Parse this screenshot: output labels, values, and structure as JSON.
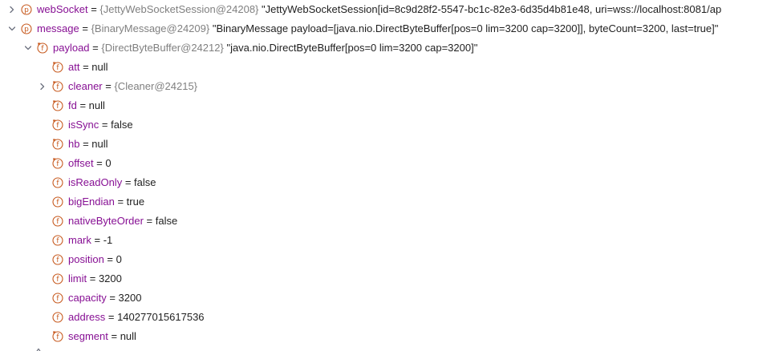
{
  "colors": {
    "field_name": "#871094",
    "type_ref": "#808080",
    "icon_orange": "#c75a1f",
    "chevron": "#6c707e"
  },
  "variables": [
    {
      "depth": 0,
      "expandable": true,
      "expanded": false,
      "icon": "p-property-icon",
      "name": "webSocket",
      "type_ref": "{JettyWebSocketSession@24208}",
      "value": "\"JettyWebSocketSession[id=8c9d28f2-5547-bc1c-82e3-6d35d4b81e48, uri=wss://localhost:8081/ap"
    },
    {
      "depth": 0,
      "expandable": true,
      "expanded": true,
      "icon": "p-property-icon",
      "name": "message",
      "type_ref": "{BinaryMessage@24209}",
      "value": "\"BinaryMessage payload=[java.nio.DirectByteBuffer[pos=0 lim=3200 cap=3200]], byteCount=3200, last=true]\""
    },
    {
      "depth": 1,
      "expandable": true,
      "expanded": true,
      "icon": "f-inherited-field-icon",
      "name": "payload",
      "type_ref": "{DirectByteBuffer@24212}",
      "value": "\"java.nio.DirectByteBuffer[pos=0 lim=3200 cap=3200]\""
    },
    {
      "depth": 2,
      "expandable": false,
      "icon": "f-inherited-field-icon",
      "name": "att",
      "type_ref": "",
      "value": "null"
    },
    {
      "depth": 2,
      "expandable": true,
      "expanded": false,
      "icon": "f-inherited-field-icon",
      "name": "cleaner",
      "type_ref": "{Cleaner@24215}",
      "value": ""
    },
    {
      "depth": 2,
      "expandable": false,
      "icon": "f-inherited-field-icon",
      "name": "fd",
      "type_ref": "",
      "value": "null"
    },
    {
      "depth": 2,
      "expandable": false,
      "icon": "f-inherited-field-icon",
      "name": "isSync",
      "type_ref": "",
      "value": "false"
    },
    {
      "depth": 2,
      "expandable": false,
      "icon": "f-inherited-field-icon",
      "name": "hb",
      "type_ref": "",
      "value": "null"
    },
    {
      "depth": 2,
      "expandable": false,
      "icon": "f-inherited-field-icon",
      "name": "offset",
      "type_ref": "",
      "value": "0"
    },
    {
      "depth": 2,
      "expandable": false,
      "icon": "f-field-icon",
      "name": "isReadOnly",
      "type_ref": "",
      "value": "false"
    },
    {
      "depth": 2,
      "expandable": false,
      "icon": "f-field-icon",
      "name": "bigEndian",
      "type_ref": "",
      "value": "true"
    },
    {
      "depth": 2,
      "expandable": false,
      "icon": "f-field-icon",
      "name": "nativeByteOrder",
      "type_ref": "",
      "value": "false"
    },
    {
      "depth": 2,
      "expandable": false,
      "icon": "f-field-icon",
      "name": "mark",
      "type_ref": "",
      "value": "-1"
    },
    {
      "depth": 2,
      "expandable": false,
      "icon": "f-field-icon",
      "name": "position",
      "type_ref": "",
      "value": "0"
    },
    {
      "depth": 2,
      "expandable": false,
      "icon": "f-field-icon",
      "name": "limit",
      "type_ref": "",
      "value": "3200"
    },
    {
      "depth": 2,
      "expandable": false,
      "icon": "f-field-icon",
      "name": "capacity",
      "type_ref": "",
      "value": "3200"
    },
    {
      "depth": 2,
      "expandable": false,
      "icon": "f-field-icon",
      "name": "address",
      "type_ref": "",
      "value": "140277015617536"
    },
    {
      "depth": 2,
      "expandable": false,
      "icon": "f-inherited-field-icon",
      "name": "segment",
      "type_ref": "",
      "value": "null"
    }
  ]
}
